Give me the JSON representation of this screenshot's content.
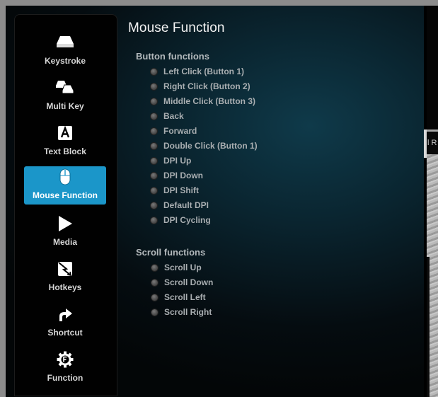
{
  "main": {
    "title": "Mouse Function",
    "button_section": {
      "title": "Button functions",
      "options": [
        "Left Click (Button 1)",
        "Right Click (Button 2)",
        "Middle Click (Button 3)",
        "Back",
        "Forward",
        "Double Click (Button 1)",
        "DPI Up",
        "DPI Down",
        "DPI Shift",
        "Default DPI",
        "DPI Cycling"
      ]
    },
    "scroll_section": {
      "title": "Scroll functions",
      "options": [
        "Scroll Up",
        "Scroll Down",
        "Scroll Left",
        "Scroll Right"
      ]
    }
  },
  "sidebar": {
    "items": [
      {
        "label": "Keystroke",
        "icon": "keycap-icon",
        "active": false
      },
      {
        "label": "Multi Key",
        "icon": "multi-keycap-icon",
        "active": false
      },
      {
        "label": "Text Block",
        "icon": "letter-a-icon",
        "active": false
      },
      {
        "label": "Mouse Function",
        "icon": "mouse-icon",
        "active": true
      },
      {
        "label": "Media",
        "icon": "play-icon",
        "active": false
      },
      {
        "label": "Hotkeys",
        "icon": "hotkey-icon",
        "active": false
      },
      {
        "label": "Shortcut",
        "icon": "shortcut-arrow-icon",
        "active": false
      },
      {
        "label": "Function",
        "icon": "function-gear-icon",
        "active": false
      }
    ]
  },
  "background_window": {
    "partial_tab_text": "l R"
  },
  "colors": {
    "active_item": "#1b96c9",
    "panel_bg": "#010101",
    "option_text": "#a9aeb1"
  }
}
